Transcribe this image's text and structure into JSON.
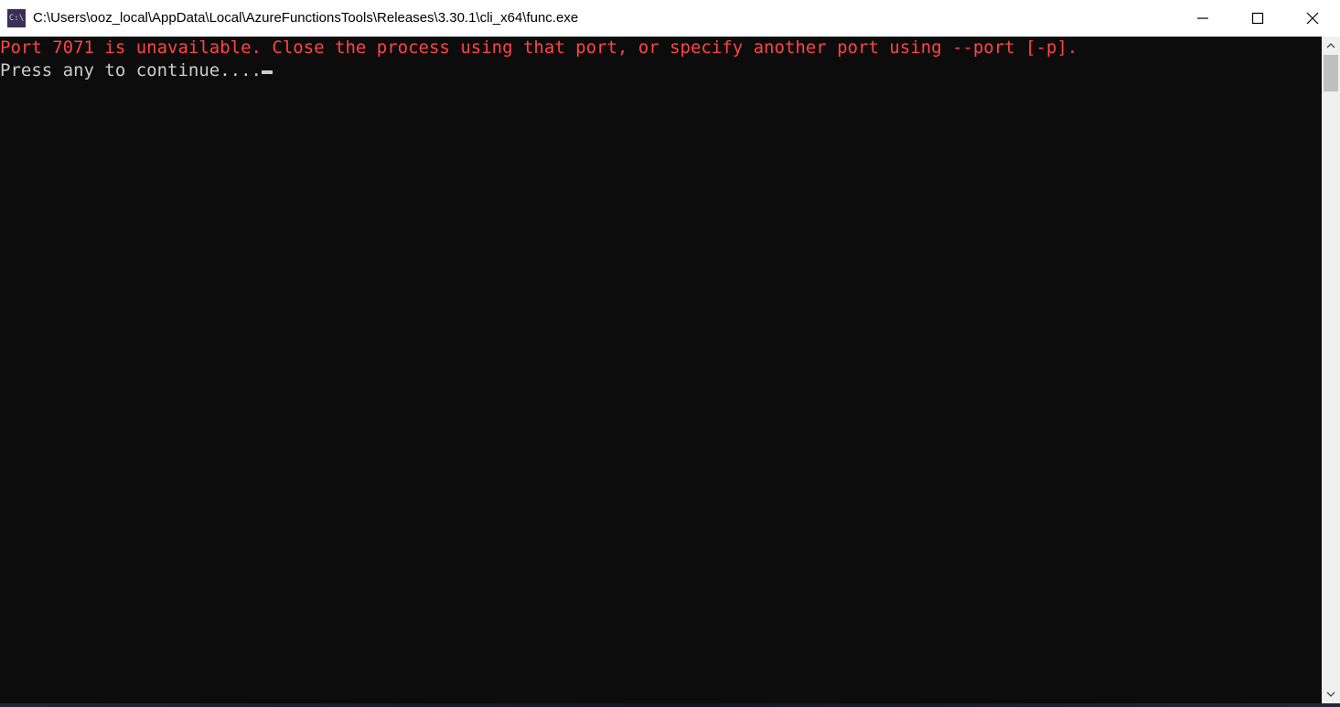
{
  "window": {
    "icon_label": "C:\\",
    "title": "C:\\Users\\ooz_local\\AppData\\Local\\AzureFunctionsTools\\Releases\\3.30.1\\cli_x64\\func.exe"
  },
  "console": {
    "error_line": "Port 7071 is unavailable. Close the process using that port, or specify another port using --port [-p].",
    "prompt_line": "Press any to continue...."
  }
}
